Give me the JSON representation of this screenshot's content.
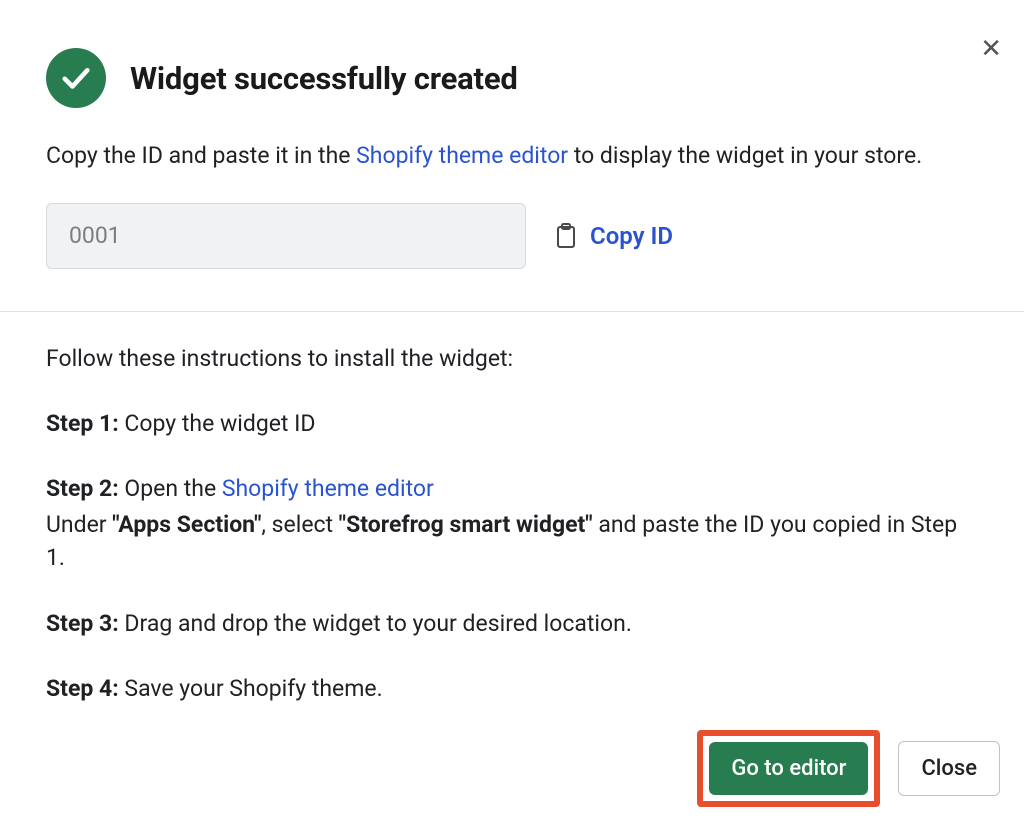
{
  "header": {
    "title": "Widget successfully created"
  },
  "lead": {
    "before": "Copy the ID and paste it in the ",
    "link": "Shopify theme editor",
    "after": " to display the widget in your store."
  },
  "id_field": {
    "value": "0001",
    "copy_label": "Copy ID"
  },
  "instructions": {
    "intro": "Follow these instructions to install the widget:",
    "step1": {
      "label": "Step 1:",
      "text": " Copy the widget ID"
    },
    "step2": {
      "label": "Step 2:",
      "text_before_link": " Open the ",
      "link": "Shopify theme editor",
      "line2_before_bold1": "Under ",
      "bold1": "\"Apps Section\"",
      "mid": ", select ",
      "bold2": "\"Storefrog smart widget\"",
      "after": " and paste the ID you copied in Step 1."
    },
    "step3": {
      "label": "Step 3:",
      "text": " Drag and drop the widget to your desired location."
    },
    "step4": {
      "label": "Step 4:",
      "text": " Save your Shopify theme."
    }
  },
  "footer": {
    "primary": "Go to editor",
    "secondary": "Close"
  }
}
